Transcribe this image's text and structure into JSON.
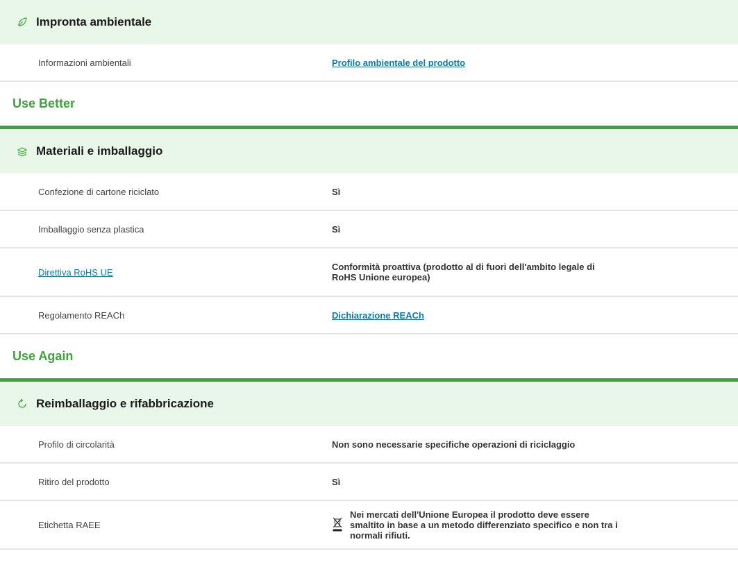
{
  "footprint": {
    "title": "Impronta ambientale",
    "icon": "leaf-icon",
    "rows": [
      {
        "label": "Informazioni ambientali",
        "value": "Profilo ambientale del prodotto"
      }
    ]
  },
  "use_better": {
    "group_title": "Use Better",
    "section_title": "Materiali e imballaggio",
    "icon": "layers-icon",
    "rows": [
      {
        "label": "Confezione di cartone riciclato",
        "value": "Sì"
      },
      {
        "label": "Imballaggio senza plastica",
        "value": "Sì"
      },
      {
        "label": "Direttiva RoHS UE",
        "value": "Conformità proattiva (prodotto al di fuori dell'ambito legale di RoHS Unione europea)"
      },
      {
        "label": "Regolamento REACh",
        "value": "Dichiarazione REACh"
      }
    ]
  },
  "use_again": {
    "group_title": "Use Again",
    "section_title": "Reimballaggio e rifabbricazione",
    "icon": "refresh-icon",
    "rows": [
      {
        "label": "Profilo di circolarità",
        "value": "Non sono necessarie specifiche operazioni di riciclaggio"
      },
      {
        "label": "Ritiro del prodotto",
        "value": "Sì"
      },
      {
        "label": "Etichetta RAEE",
        "value": "Nei mercati dell'Unione Europea il prodotto deve essere smaltito in base a un metodo differenziato specifico e non tra i normali rifiuti."
      }
    ]
  },
  "colors": {
    "accent_green": "#3da33d",
    "header_bg": "#e8f7e8",
    "link": "#0e7aa6"
  }
}
